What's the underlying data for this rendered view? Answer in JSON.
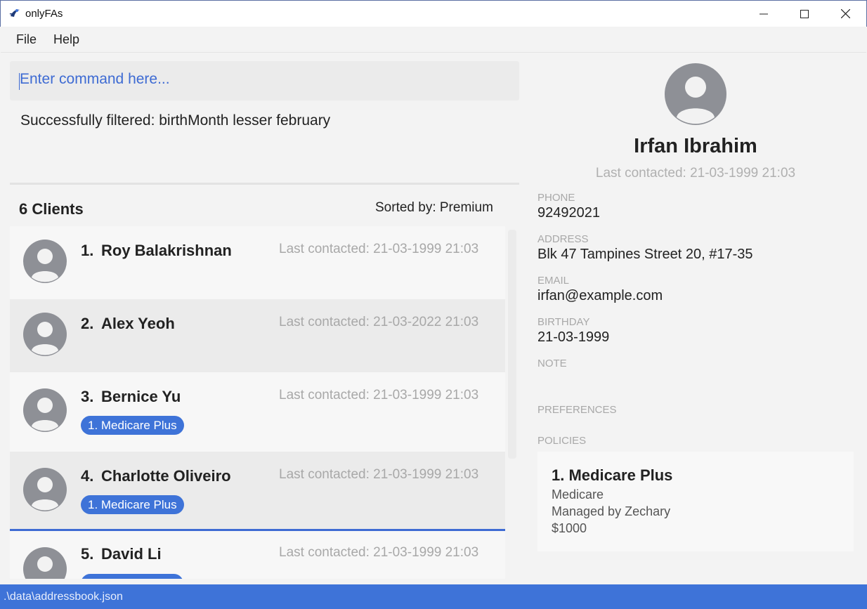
{
  "window": {
    "title": "onlyFAs"
  },
  "menu": {
    "items": [
      "File",
      "Help"
    ]
  },
  "command": {
    "placeholder": "Enter command here..."
  },
  "result": {
    "message": "Successfully filtered: birthMonth lesser february"
  },
  "list": {
    "count_label": "6 Clients",
    "sort_label": "Sorted by: Premium",
    "clients": [
      {
        "index": "1.",
        "name": "Roy Balakrishnan",
        "last_contacted": "Last contacted: 21-03-1999 21:03",
        "policies": []
      },
      {
        "index": "2.",
        "name": "Alex Yeoh",
        "last_contacted": "Last contacted: 21-03-2022 21:03",
        "policies": []
      },
      {
        "index": "3.",
        "name": "Bernice Yu",
        "last_contacted": "Last contacted: 21-03-1999 21:03",
        "policies": [
          "1. Medicare Plus"
        ]
      },
      {
        "index": "4.",
        "name": "Charlotte Oliveiro",
        "last_contacted": "Last contacted: 21-03-1999 21:03",
        "policies": [
          "1. Medicare Plus"
        ]
      },
      {
        "index": "5.",
        "name": "David Li",
        "last_contacted": "Last contacted: 21-03-1999 21:03",
        "policies": [
          ""
        ]
      }
    ]
  },
  "detail": {
    "name": "Irfan Ibrahim",
    "last_contacted": "Last contacted: 21-03-1999 21:03",
    "phone_label": "PHONE",
    "phone": "92492021",
    "address_label": "ADDRESS",
    "address": "Blk 47 Tampines Street 20, #17-35",
    "email_label": "EMAIL",
    "email": "irfan@example.com",
    "birthday_label": "BIRTHDAY",
    "birthday": "21-03-1999",
    "note_label": "NOTE",
    "preferences_label": "PREFERENCES",
    "policies_label": "POLICIES",
    "policy": {
      "title": "1.  Medicare Plus",
      "type": "Medicare",
      "manager": "Managed by Zechary",
      "premium": "$1000"
    }
  },
  "status": {
    "path": ".\\data\\addressbook.json"
  },
  "colors": {
    "accent": "#3e73d8",
    "muted": "#a8a8a8"
  }
}
